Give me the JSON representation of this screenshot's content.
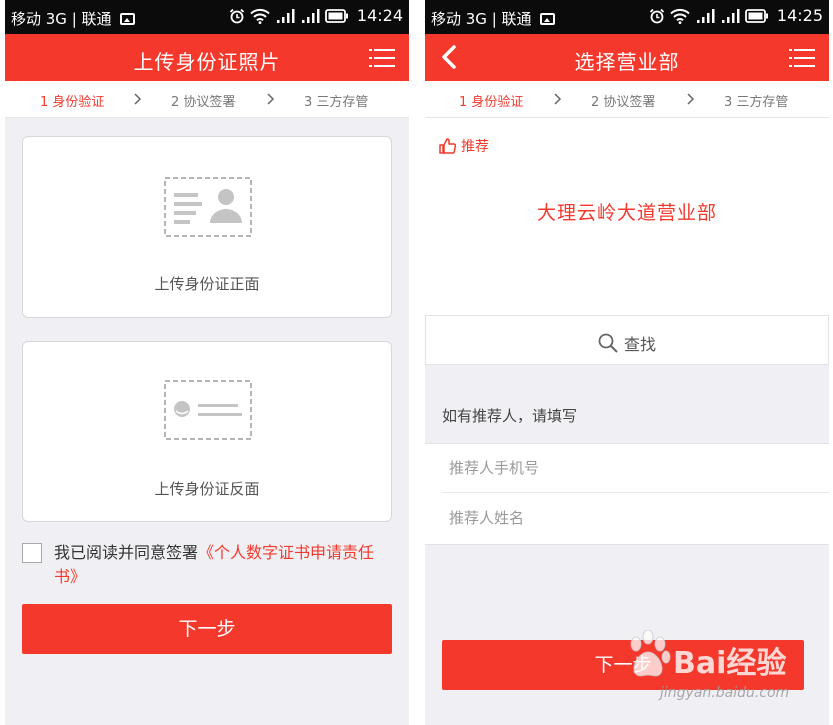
{
  "colors": {
    "brand": "#f4382c",
    "status_bar": "#0b0b0b",
    "background": "#f0f0f4"
  },
  "screen1": {
    "status": {
      "carrier": "移动 3G | 联通",
      "time": "14:24"
    },
    "title": "上传身份证照片",
    "steps": [
      {
        "label": "1 身份验证",
        "active": true
      },
      {
        "label": "2 协议签署",
        "active": false
      },
      {
        "label": "3 三方存管",
        "active": false
      }
    ],
    "front_card": {
      "label": "上传身份证正面",
      "icon": "id-card-front-icon"
    },
    "back_card": {
      "label": "上传身份证反面",
      "icon": "id-card-back-icon"
    },
    "agreement": {
      "prefix": "我已阅读并同意签署",
      "link": "《个人数字证书申请责任书》",
      "checked": false
    },
    "next_button": "下一步"
  },
  "screen2": {
    "status": {
      "carrier": "移动 3G | 联通",
      "time": "14:25"
    },
    "title": "选择营业部",
    "steps": [
      {
        "label": "1 身份验证",
        "active": true
      },
      {
        "label": "2 协议签署",
        "active": false
      },
      {
        "label": "3 三方存管",
        "active": false
      }
    ],
    "recommend_label": "推荐",
    "recommended_branch": "大理云岭大道营业部",
    "search_label": "查找",
    "referrer_heading": "如有推荐人，请填写",
    "referrer_phone_placeholder": "推荐人手机号",
    "referrer_name_placeholder": "推荐人姓名",
    "next_button": "下一步"
  },
  "watermark": {
    "brand": "Bai经验",
    "url": "jingyan.baidu.com"
  }
}
